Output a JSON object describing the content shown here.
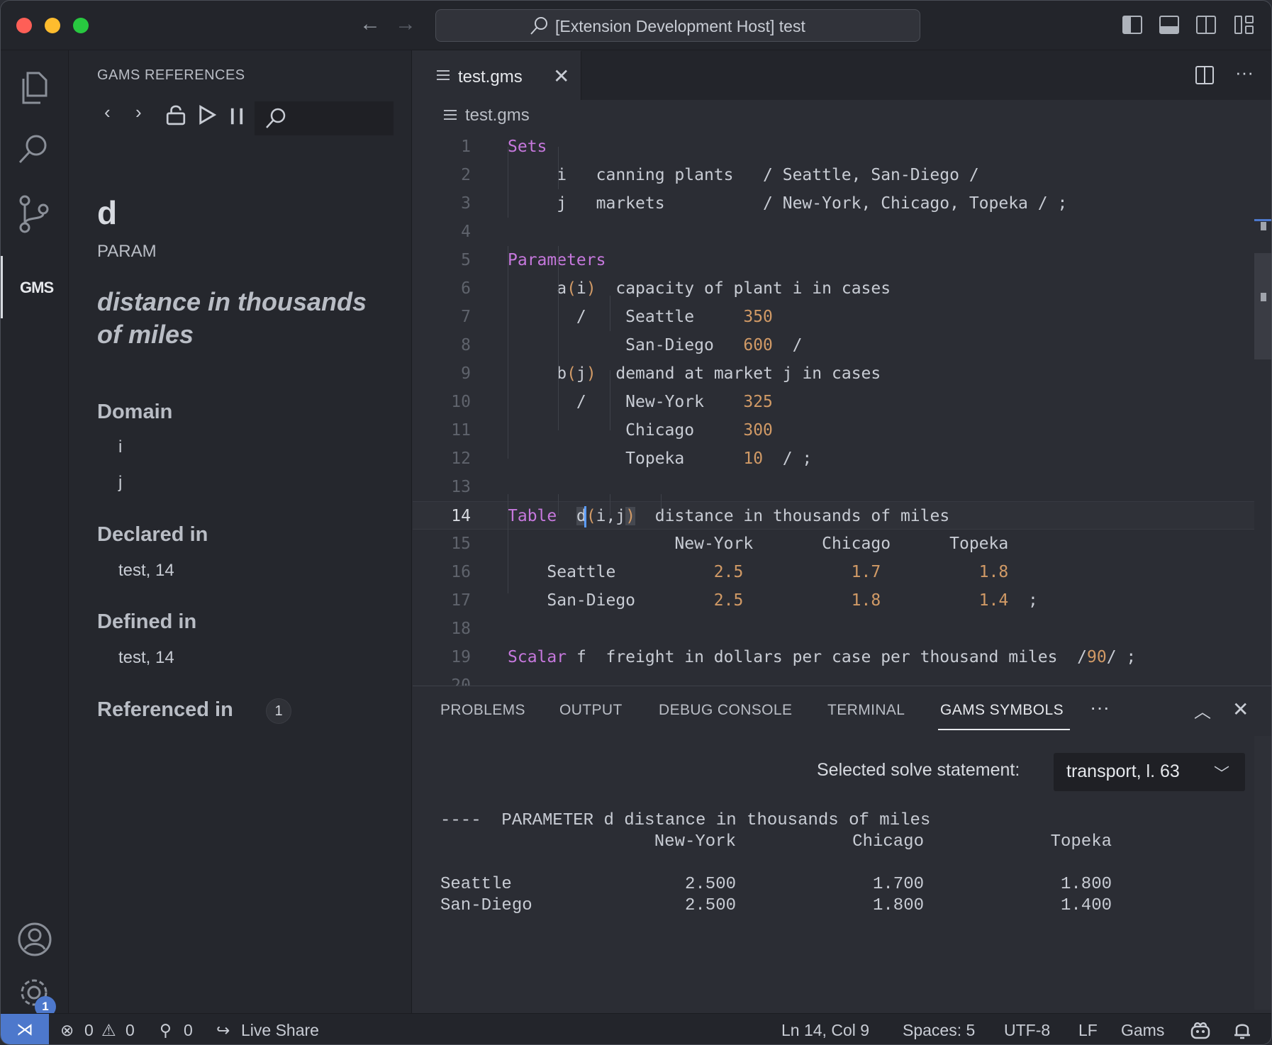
{
  "window": {
    "title": "[Extension Development Host] test"
  },
  "activity_bar": {
    "gms_label": "GMS",
    "settings_badge": "1"
  },
  "sidebar": {
    "title": "GAMS REFERENCES",
    "symbol": {
      "name": "d",
      "kind": "PARAM",
      "description": "distance in thousands of miles"
    },
    "domain_heading": "Domain",
    "domain_items": [
      "i",
      "j"
    ],
    "declared_heading": "Declared in",
    "declared_value": "test, 14",
    "defined_heading": "Defined in",
    "defined_value": "test, 14",
    "referenced_heading": "Referenced in",
    "referenced_count": "1"
  },
  "editor": {
    "tab_label": "test.gms",
    "breadcrumb": "test.gms",
    "current_line": 14,
    "lines": [
      {
        "n": "1",
        "segs": [
          {
            "t": "Sets",
            "c": "kw"
          }
        ]
      },
      {
        "n": "2",
        "segs": [
          {
            "t": "     i   canning plants   / Seattle, San-Diego /",
            "c": ""
          }
        ]
      },
      {
        "n": "3",
        "segs": [
          {
            "t": "     j   markets          / New-York, Chicago, Topeka / ;",
            "c": ""
          }
        ]
      },
      {
        "n": "4",
        "segs": []
      },
      {
        "n": "5",
        "segs": [
          {
            "t": "Parameters",
            "c": "kw"
          }
        ]
      },
      {
        "n": "6",
        "segs": [
          {
            "t": "     a",
            "c": ""
          },
          {
            "t": "(",
            "c": "num"
          },
          {
            "t": "i",
            "c": ""
          },
          {
            "t": ")",
            "c": "num"
          },
          {
            "t": "  capacity of plant i in cases",
            "c": ""
          }
        ]
      },
      {
        "n": "7",
        "segs": [
          {
            "t": "       /    Seattle     ",
            "c": ""
          },
          {
            "t": "350",
            "c": "num"
          }
        ]
      },
      {
        "n": "8",
        "segs": [
          {
            "t": "            San-Diego   ",
            "c": ""
          },
          {
            "t": "600",
            "c": "num"
          },
          {
            "t": "  /",
            "c": ""
          }
        ]
      },
      {
        "n": "9",
        "segs": [
          {
            "t": "     b",
            "c": ""
          },
          {
            "t": "(",
            "c": "num"
          },
          {
            "t": "j",
            "c": ""
          },
          {
            "t": ")",
            "c": "num"
          },
          {
            "t": "  demand at market j in cases",
            "c": ""
          }
        ]
      },
      {
        "n": "10",
        "segs": [
          {
            "t": "       /    New-York    ",
            "c": ""
          },
          {
            "t": "325",
            "c": "num"
          }
        ]
      },
      {
        "n": "11",
        "segs": [
          {
            "t": "            Chicago     ",
            "c": ""
          },
          {
            "t": "300",
            "c": "num"
          }
        ]
      },
      {
        "n": "12",
        "segs": [
          {
            "t": "            Topeka      ",
            "c": ""
          },
          {
            "t": "10",
            "c": "num"
          },
          {
            "t": "  / ;",
            "c": ""
          }
        ]
      },
      {
        "n": "13",
        "segs": []
      },
      {
        "n": "14",
        "segs": [
          {
            "t": "Table",
            "c": "kw"
          },
          {
            "t": "  ",
            "c": ""
          },
          {
            "t": "d",
            "c": "hl"
          },
          {
            "t": "(",
            "c": "num"
          },
          {
            "t": "i,j",
            "c": ""
          },
          {
            "t": ")",
            "c": "num hl"
          },
          {
            "t": "  distance in thousands of miles",
            "c": ""
          }
        ]
      },
      {
        "n": "15",
        "segs": [
          {
            "t": "                 New-York       Chicago      Topeka",
            "c": ""
          }
        ]
      },
      {
        "n": "16",
        "segs": [
          {
            "t": "    Seattle          ",
            "c": ""
          },
          {
            "t": "2.5",
            "c": "num"
          },
          {
            "t": "           ",
            "c": ""
          },
          {
            "t": "1.7",
            "c": "num"
          },
          {
            "t": "          ",
            "c": ""
          },
          {
            "t": "1.8",
            "c": "num"
          }
        ]
      },
      {
        "n": "17",
        "segs": [
          {
            "t": "    San-Diego        ",
            "c": ""
          },
          {
            "t": "2.5",
            "c": "num"
          },
          {
            "t": "           ",
            "c": ""
          },
          {
            "t": "1.8",
            "c": "num"
          },
          {
            "t": "          ",
            "c": ""
          },
          {
            "t": "1.4",
            "c": "num"
          },
          {
            "t": "  ;",
            "c": ""
          }
        ]
      },
      {
        "n": "18",
        "segs": []
      },
      {
        "n": "19",
        "segs": [
          {
            "t": "Scalar",
            "c": "kw"
          },
          {
            "t": " f  freight in dollars per case per thousand miles  /",
            "c": ""
          },
          {
            "t": "90",
            "c": "num"
          },
          {
            "t": "/ ;",
            "c": ""
          }
        ]
      },
      {
        "n": "20",
        "segs": []
      }
    ]
  },
  "panel": {
    "tabs": [
      "PROBLEMS",
      "OUTPUT",
      "DEBUG CONSOLE",
      "TERMINAL",
      "GAMS SYMBOLS"
    ],
    "more": "···",
    "solve_label": "Selected solve statement:",
    "solve_value": "transport, l. 63",
    "listing": {
      "header": "----  PARAMETER d distance in thousands of miles",
      "columns": [
        "New-York",
        "Chicago",
        "Topeka"
      ],
      "rows": [
        {
          "label": "Seattle",
          "values": [
            "2.500",
            "1.700",
            "1.800"
          ]
        },
        {
          "label": "San-Diego",
          "values": [
            "2.500",
            "1.800",
            "1.400"
          ]
        }
      ]
    }
  },
  "status_bar": {
    "errors": "0",
    "warnings": "0",
    "ports": "0",
    "live_share": "Live Share",
    "position": "Ln 14, Col 9",
    "spaces": "Spaces: 5",
    "encoding": "UTF-8",
    "eol": "LF",
    "language": "Gams"
  },
  "colors": {
    "keyword": "#c678dd",
    "number": "#d19a66",
    "accent": "#4d78cc"
  }
}
